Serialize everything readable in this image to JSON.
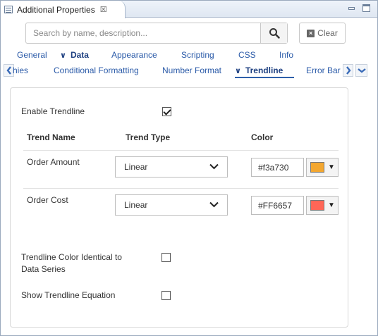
{
  "window": {
    "title": "Additional Properties",
    "close_glyph": "☒"
  },
  "search": {
    "placeholder": "Search by name, description...",
    "value": "",
    "clear_label": "Clear"
  },
  "tabs_row1": [
    {
      "label": "General",
      "active": false
    },
    {
      "label": "Data",
      "active": true
    },
    {
      "label": "Appearance",
      "active": false
    },
    {
      "label": "Scripting",
      "active": false
    },
    {
      "label": "CSS",
      "active": false
    },
    {
      "label": "Info",
      "active": false
    }
  ],
  "tabs_row2": [
    {
      "label": "hies",
      "active": false
    },
    {
      "label": "Conditional Formatting",
      "active": false
    },
    {
      "label": "Number Format",
      "active": false
    },
    {
      "label": "Trendline",
      "active": true
    },
    {
      "label": "Error Bar",
      "active": false
    }
  ],
  "nav": {
    "prev_icon": "chevron-left-icon",
    "next_icon": "chevron-right-icon",
    "more_icon": "chevron-down-icon"
  },
  "panel": {
    "enable_trendline": {
      "label": "Enable Trendline",
      "checked": true
    },
    "headers": {
      "name": "Trend Name",
      "type": "Trend Type",
      "color": "Color"
    },
    "trends": [
      {
        "name": "Order Amount",
        "type": "Linear",
        "color": "#f3a730",
        "swatch": "#f3a730"
      },
      {
        "name": "Order Cost",
        "type": "Linear",
        "color": "#FF6657",
        "swatch": "#FF6657"
      }
    ],
    "identical_color": {
      "label": "Trendline Color Identical to Data Series",
      "checked": false
    },
    "show_equation": {
      "label": "Show Trendline Equation",
      "checked": false
    }
  },
  "colors": {
    "accent": "#2d5faa",
    "tab_text": "#2a5aa8",
    "border": "#c8c8c8"
  }
}
